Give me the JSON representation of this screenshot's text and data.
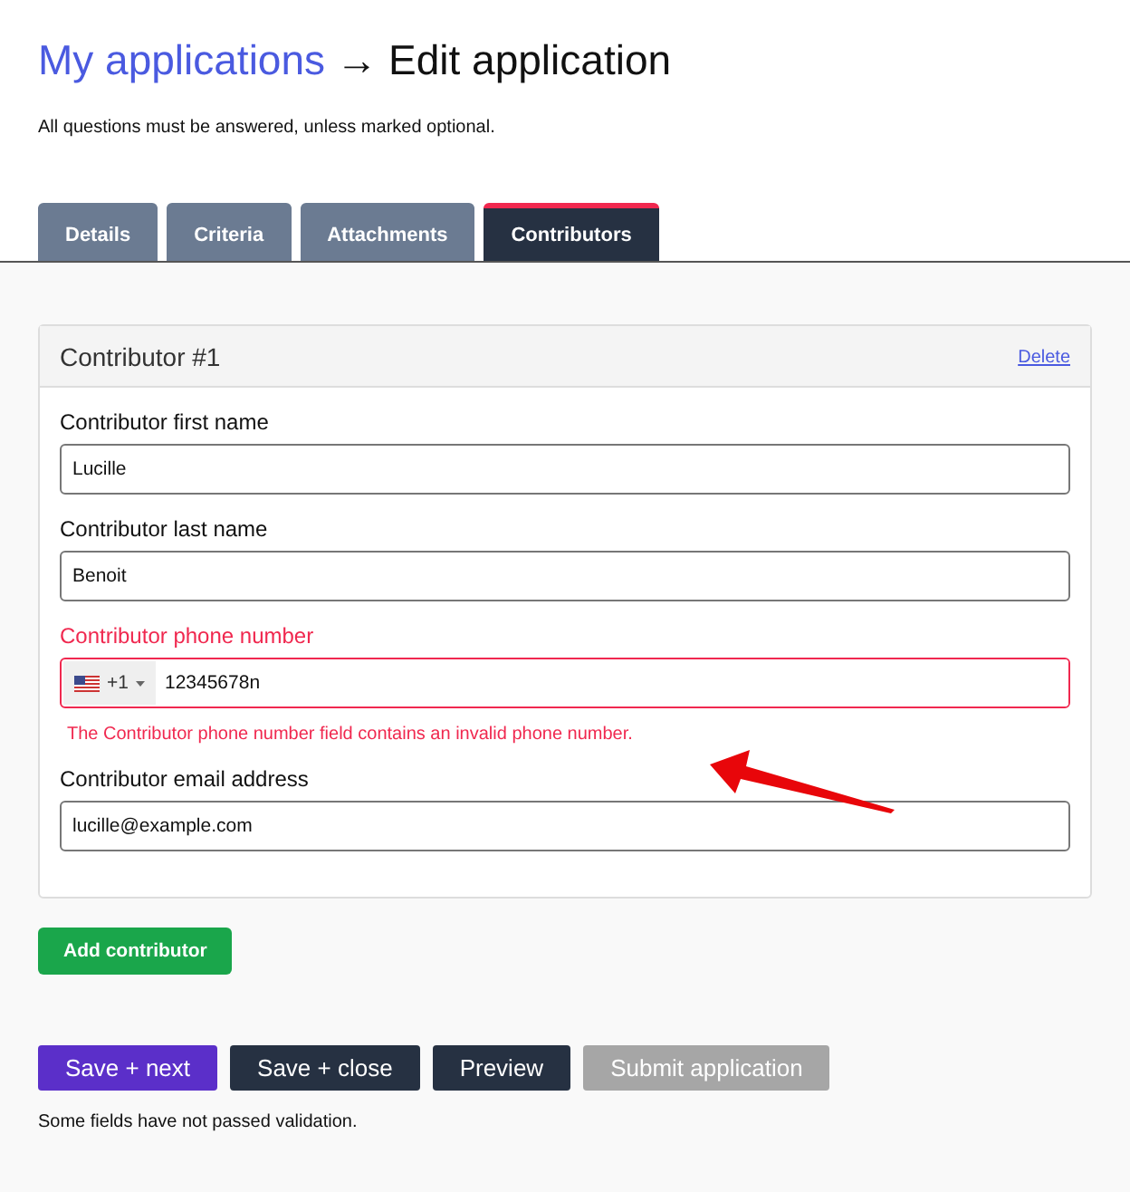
{
  "breadcrumb": {
    "parent": "My applications",
    "separator": "→",
    "current": "Edit application"
  },
  "intro": "All questions must be answered, unless marked optional.",
  "tabs": [
    {
      "label": "Details",
      "selected": false
    },
    {
      "label": "Criteria",
      "selected": false
    },
    {
      "label": "Attachments",
      "selected": false
    },
    {
      "label": "Contributors",
      "selected": true
    }
  ],
  "contributors": [
    {
      "title": "Contributor #1",
      "delete_link": "Delete",
      "fields": [
        {
          "kind": "text",
          "label": "Contributor first name",
          "value": "Lucille",
          "invalid": false
        },
        {
          "kind": "text",
          "label": "Contributor last name",
          "value": "Benoit",
          "invalid": false
        },
        {
          "kind": "phone",
          "label": "Contributor phone number",
          "country_code": "+1",
          "value": "12345678n",
          "invalid": true,
          "error": "The Contributor phone number field contains an invalid phone number."
        },
        {
          "kind": "text",
          "label": "Contributor email address",
          "value": "lucille@example.com",
          "invalid": false
        }
      ]
    }
  ],
  "add_button": "Add contributor",
  "actions": [
    {
      "label": "Save + next",
      "kind": "primary",
      "disabled": false
    },
    {
      "label": "Save + close",
      "kind": "dark",
      "disabled": false
    },
    {
      "label": "Preview",
      "kind": "dark",
      "disabled": false
    },
    {
      "label": "Submit application",
      "kind": "dark",
      "disabled": true
    }
  ],
  "validation_message": "Some fields have not passed validation."
}
